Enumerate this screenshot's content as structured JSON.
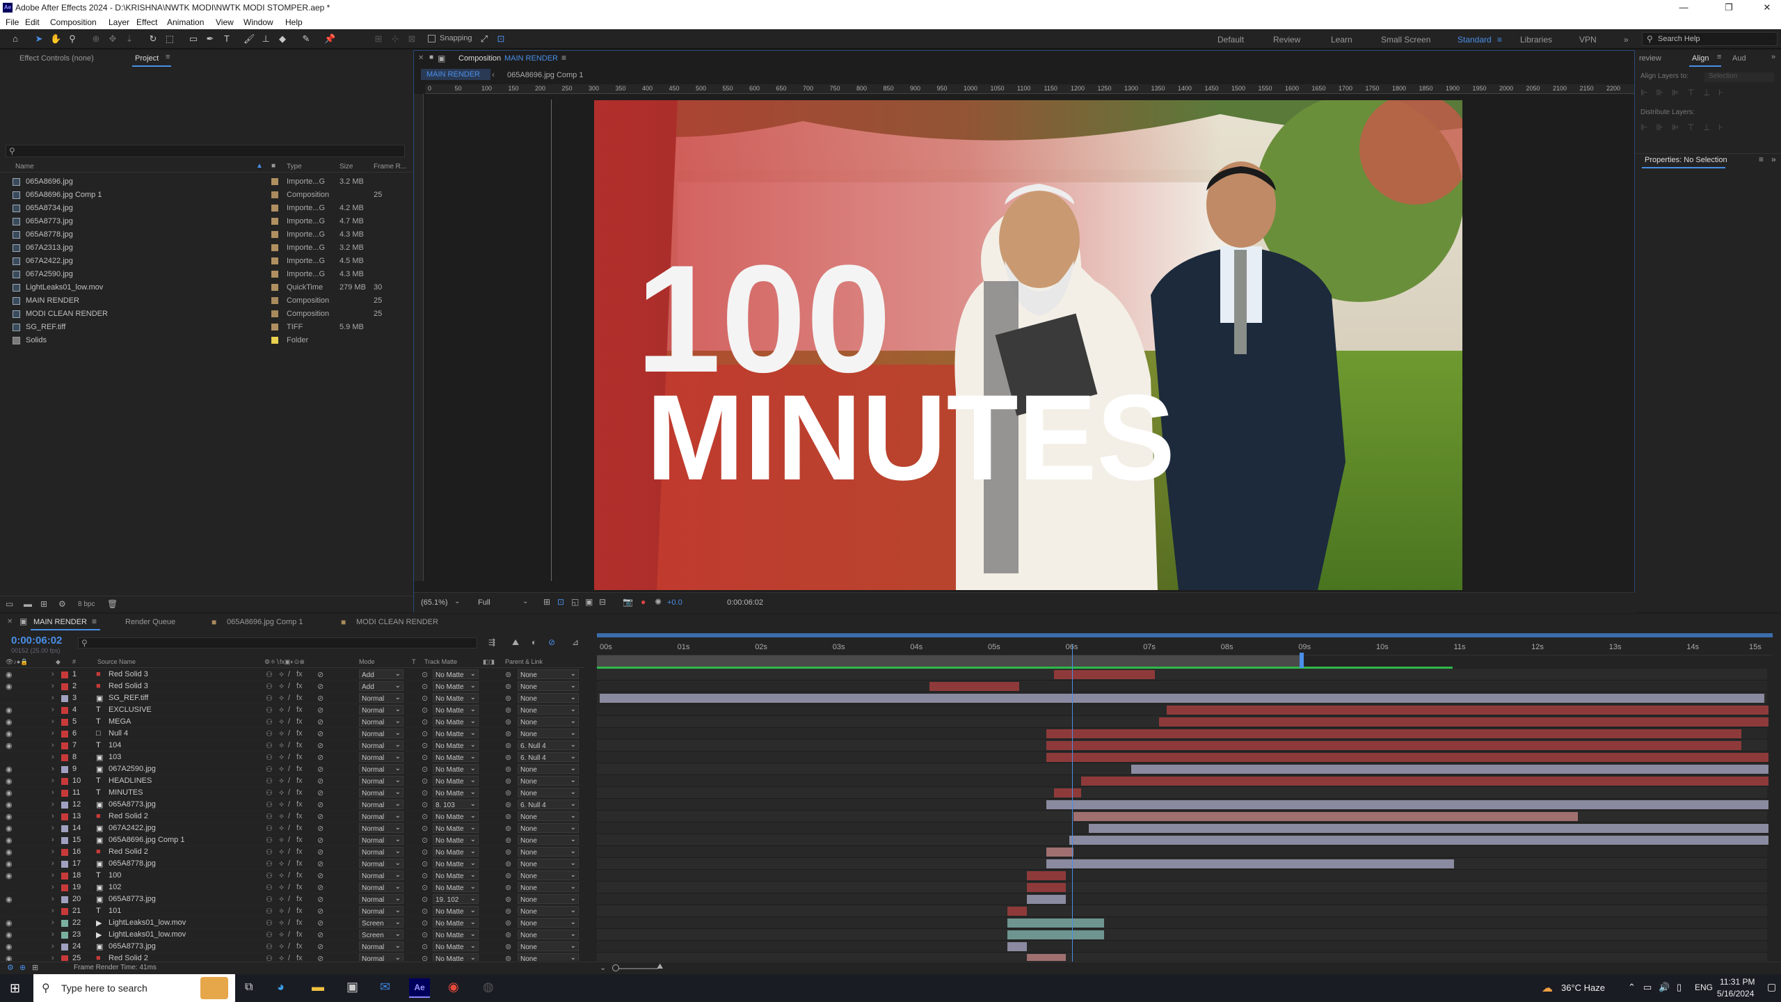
{
  "window": {
    "title": "Adobe After Effects 2024 - D:\\KRISHNA\\NWTK MODI\\NWTK MODI STOMPER.aep *",
    "app_icon": "Ae"
  },
  "menu": [
    "File",
    "Edit",
    "Composition",
    "Layer",
    "Effect",
    "Animation",
    "View",
    "Window",
    "Help"
  ],
  "toolbar": {
    "snapping_label": "Snapping"
  },
  "workspaces": [
    "Default",
    "Review",
    "Learn",
    "Small Screen",
    "Standard",
    "Libraries",
    "VPN"
  ],
  "active_workspace": "Standard",
  "search_help": "Search Help",
  "project_panel": {
    "tab_effect": "Effect Controls (none)",
    "tab_project": "Project",
    "columns": {
      "name": "Name",
      "type": "Type",
      "size": "Size",
      "frame_rate": "Frame R..."
    },
    "items": [
      {
        "name": "065A8696.jpg",
        "type": "Importe...G",
        "size": "3.2 MB",
        "fr": "",
        "label": "#b09060"
      },
      {
        "name": "065A8696.jpg Comp 1",
        "type": "Composition",
        "size": "",
        "fr": "25",
        "label": "#a88a5c"
      },
      {
        "name": "065A8734.jpg",
        "type": "Importe...G",
        "size": "4.2 MB",
        "fr": "",
        "label": "#b09060"
      },
      {
        "name": "065A8773.jpg",
        "type": "Importe...G",
        "size": "4.7 MB",
        "fr": "",
        "label": "#b09060"
      },
      {
        "name": "065A8778.jpg",
        "type": "Importe...G",
        "size": "4.3 MB",
        "fr": "",
        "label": "#b09060"
      },
      {
        "name": "067A2313.jpg",
        "type": "Importe...G",
        "size": "3.2 MB",
        "fr": "",
        "label": "#b09060"
      },
      {
        "name": "067A2422.jpg",
        "type": "Importe...G",
        "size": "4.5 MB",
        "fr": "",
        "label": "#b09060"
      },
      {
        "name": "067A2590.jpg",
        "type": "Importe...G",
        "size": "4.3 MB",
        "fr": "",
        "label": "#b09060"
      },
      {
        "name": "LightLeaks01_low.mov",
        "type": "QuickTime",
        "size": "279 MB",
        "fr": "30",
        "label": "#b09060"
      },
      {
        "name": "MAIN RENDER",
        "type": "Composition",
        "size": "",
        "fr": "25",
        "label": "#a88a5c"
      },
      {
        "name": "MODI CLEAN RENDER",
        "type": "Composition",
        "size": "",
        "fr": "25",
        "label": "#a88a5c"
      },
      {
        "name": "SG_REF.tiff",
        "type": "TIFF",
        "size": "5.9 MB",
        "fr": "",
        "label": "#b09060"
      },
      {
        "name": "Solids",
        "type": "Folder",
        "size": "",
        "fr": "",
        "label": "#e8d050"
      }
    ],
    "bpc": "8 bpc"
  },
  "composition": {
    "header": "Composition",
    "comp_name": "MAIN RENDER",
    "crumbs": [
      "MAIN RENDER",
      "065A8696.jpg Comp 1"
    ],
    "ruler_ticks": [
      "0",
      "50",
      "100",
      "150",
      "200",
      "250",
      "300",
      "350",
      "400",
      "450",
      "500",
      "550",
      "600",
      "650",
      "700",
      "750",
      "800",
      "850",
      "900",
      "950",
      "1000",
      "1050",
      "1100",
      "1150",
      "1200",
      "1250",
      "1300",
      "1350",
      "1400",
      "1450",
      "1500",
      "1550",
      "1600",
      "1650",
      "1700",
      "1750",
      "1800",
      "1850",
      "1900",
      "1950",
      "2000",
      "2050",
      "2100",
      "2150",
      "2200"
    ],
    "zoom": "(65.1%)",
    "resolution": "Full",
    "timecode": "0:00:06:02",
    "exposure": "+0.0",
    "art_text_big": "100",
    "art_text_minutes": "MINUTES"
  },
  "right_panel": {
    "tab_preview": "review",
    "tab_align": "Align",
    "tab_audio": "Aud",
    "align_layers_to": "Align Layers to:",
    "align_target": "Selection",
    "distribute_layers": "Distribute Layers:",
    "properties": "Properties: No Selection"
  },
  "timeline": {
    "tabs": [
      "MAIN RENDER",
      "Render Queue",
      "065A8696.jpg Comp 1",
      "MODI CLEAN RENDER"
    ],
    "timecode": "0:00:06:02",
    "frame_info": "00152 (25.00 fps)",
    "columns": {
      "source": "Source Name",
      "mode": "Mode",
      "t": "T",
      "track_matte": "Track Matte",
      "parent": "Parent & Link"
    },
    "time_ticks": [
      "00s",
      "01s",
      "02s",
      "03s",
      "04s",
      "05s",
      "06s",
      "07s",
      "08s",
      "09s",
      "10s",
      "11s",
      "12s",
      "13s",
      "14s",
      "15s"
    ],
    "render_time": "Frame Render Time: 41ms",
    "playhead_sec": 6.08,
    "layers": [
      {
        "n": "1",
        "name": "Red Solid 3",
        "icon": "solid",
        "label": "#c83a3a",
        "mode": "Add",
        "matte": "No Matte",
        "parent": "None",
        "vis": true,
        "start": 5.85,
        "end": 7.15,
        "color": "#8f3a3a"
      },
      {
        "n": "2",
        "name": "Red Solid 3",
        "icon": "solid",
        "label": "#c83a3a",
        "mode": "Add",
        "matte": "No Matte",
        "parent": "None",
        "vis": true,
        "start": 4.25,
        "end": 5.4,
        "color": "#8f3a3a"
      },
      {
        "n": "3",
        "name": "SG_REF.tiff",
        "icon": "image",
        "label": "#a0a0c0",
        "mode": "Normal",
        "matte": "No Matte",
        "parent": "None",
        "vis": false,
        "start": 0,
        "end": 15,
        "color": "#8a8aa0"
      },
      {
        "n": "4",
        "name": "EXCLUSIVE",
        "icon": "text",
        "label": "#c83a3a",
        "mode": "Normal",
        "matte": "No Matte",
        "parent": "None",
        "vis": true,
        "start": 7.3,
        "end": 15.05,
        "color": "#8f3a3a"
      },
      {
        "n": "5",
        "name": "MEGA",
        "icon": "text",
        "label": "#c83a3a",
        "mode": "Normal",
        "matte": "No Matte",
        "parent": "None",
        "vis": true,
        "start": 7.2,
        "end": 15.05,
        "color": "#8f3a3a"
      },
      {
        "n": "6",
        "name": "Null 4",
        "icon": "null",
        "label": "#c83a3a",
        "mode": "Normal",
        "matte": "No Matte",
        "parent": "None",
        "vis": true,
        "start": 5.75,
        "end": 14.7,
        "color": "#8f3a3a"
      },
      {
        "n": "7",
        "name": "104",
        "icon": "text",
        "label": "#c83a3a",
        "mode": "Normal",
        "matte": "No Matte",
        "parent": "6. Null 4",
        "vis": true,
        "start": 5.75,
        "end": 14.7,
        "color": "#8f3a3a"
      },
      {
        "n": "8",
        "name": "103",
        "icon": "precomp",
        "label": "#c83a3a",
        "mode": "Normal",
        "matte": "No Matte",
        "parent": "6. Null 4",
        "vis": false,
        "start": 5.75,
        "end": 15.05,
        "color": "#8f3a3a"
      },
      {
        "n": "9",
        "name": "067A2590.jpg",
        "icon": "image",
        "label": "#a0a0c0",
        "mode": "Normal",
        "matte": "No Matte",
        "parent": "None",
        "vis": true,
        "start": 6.85,
        "end": 15.05,
        "color": "#8a8aa0"
      },
      {
        "n": "10",
        "name": "HEADLINES",
        "icon": "text",
        "label": "#c83a3a",
        "mode": "Normal",
        "matte": "No Matte",
        "parent": "None",
        "vis": true,
        "start": 6.2,
        "end": 15.05,
        "color": "#8f3a3a"
      },
      {
        "n": "11",
        "name": "MINUTES",
        "icon": "text",
        "label": "#c83a3a",
        "mode": "Normal",
        "matte": "No Matte",
        "parent": "None",
        "vis": true,
        "start": 5.85,
        "end": 6.2,
        "color": "#8f3a3a"
      },
      {
        "n": "12",
        "name": "065A8773.jpg",
        "icon": "precomp",
        "label": "#a0a0c0",
        "mode": "Normal",
        "matte": "8. 103",
        "parent": "6. Null 4",
        "vis": true,
        "start": 5.75,
        "end": 15.05,
        "color": "#8a8aa0"
      },
      {
        "n": "13",
        "name": "Red Solid 2",
        "icon": "solid",
        "label": "#c83a3a",
        "mode": "Normal",
        "matte": "No Matte",
        "parent": "None",
        "vis": true,
        "start": 6.1,
        "end": 12.6,
        "color": "#a07070"
      },
      {
        "n": "14",
        "name": "067A2422.jpg",
        "icon": "image",
        "label": "#a0a0c0",
        "mode": "Normal",
        "matte": "No Matte",
        "parent": "None",
        "vis": true,
        "start": 6.3,
        "end": 15.05,
        "color": "#8a8aa0"
      },
      {
        "n": "15",
        "name": "065A8696.jpg Comp 1",
        "icon": "precomp",
        "label": "#a0a0c0",
        "mode": "Normal",
        "matte": "No Matte",
        "parent": "None",
        "vis": true,
        "start": 6.05,
        "end": 15.05,
        "color": "#8a8aa0"
      },
      {
        "n": "16",
        "name": "Red Solid 2",
        "icon": "solid",
        "label": "#c83a3a",
        "mode": "Normal",
        "matte": "No Matte",
        "parent": "None",
        "vis": true,
        "start": 5.75,
        "end": 6.1,
        "color": "#a07070"
      },
      {
        "n": "17",
        "name": "065A8778.jpg",
        "icon": "image",
        "label": "#a0a0c0",
        "mode": "Normal",
        "matte": "No Matte",
        "parent": "None",
        "vis": true,
        "start": 5.75,
        "end": 11.0,
        "color": "#8a8aa0"
      },
      {
        "n": "18",
        "name": "100",
        "icon": "text",
        "label": "#c83a3a",
        "mode": "Normal",
        "matte": "No Matte",
        "parent": "None",
        "vis": true,
        "start": 5.5,
        "end": 6.0,
        "color": "#8f3a3a"
      },
      {
        "n": "19",
        "name": "102",
        "icon": "precomp",
        "label": "#c83a3a",
        "mode": "Normal",
        "matte": "No Matte",
        "parent": "None",
        "vis": false,
        "start": 5.5,
        "end": 6.0,
        "color": "#8f3a3a"
      },
      {
        "n": "20",
        "name": "065A8773.jpg",
        "icon": "precomp",
        "label": "#a0a0c0",
        "mode": "Normal",
        "matte": "19. 102",
        "parent": "None",
        "vis": true,
        "start": 5.5,
        "end": 6.0,
        "color": "#8a8aa0"
      },
      {
        "n": "21",
        "name": "101",
        "icon": "text",
        "label": "#c83a3a",
        "mode": "Normal",
        "matte": "No Matte",
        "parent": "None",
        "vis": false,
        "start": 5.25,
        "end": 5.5,
        "color": "#8f3a3a"
      },
      {
        "n": "22",
        "name": "LightLeaks01_low.mov",
        "icon": "video",
        "label": "#7ab0a0",
        "mode": "Screen",
        "matte": "No Matte",
        "parent": "None",
        "vis": true,
        "start": 5.25,
        "end": 6.5,
        "color": "#6e9590"
      },
      {
        "n": "23",
        "name": "LightLeaks01_low.mov",
        "icon": "video",
        "label": "#7ab0a0",
        "mode": "Screen",
        "matte": "No Matte",
        "parent": "None",
        "vis": true,
        "start": 5.25,
        "end": 6.5,
        "color": "#6e9590"
      },
      {
        "n": "24",
        "name": "065A8773.jpg",
        "icon": "image",
        "label": "#a0a0c0",
        "mode": "Normal",
        "matte": "No Matte",
        "parent": "None",
        "vis": true,
        "start": 5.25,
        "end": 5.5,
        "color": "#8a8aa0"
      },
      {
        "n": "25",
        "name": "Red Solid 2",
        "icon": "solid",
        "label": "#c83a3a",
        "mode": "Normal",
        "matte": "No Matte",
        "parent": "None",
        "vis": true,
        "start": 5.5,
        "end": 6.0,
        "color": "#a07070"
      }
    ]
  },
  "taskbar": {
    "search_placeholder": "Type here to search",
    "weather": "36°C  Haze",
    "lang": "ENG",
    "time": "11:31 PM",
    "date": "5/16/2024"
  }
}
